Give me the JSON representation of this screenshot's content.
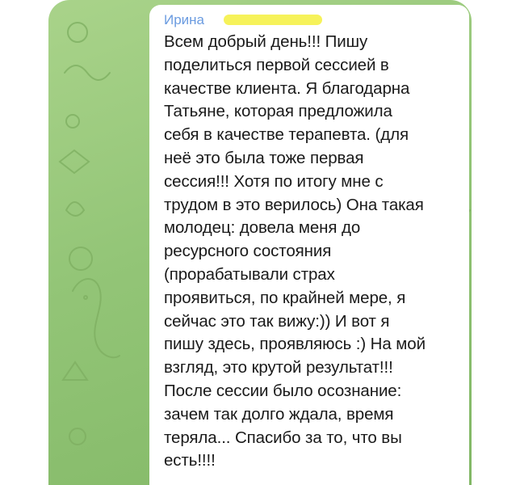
{
  "message": {
    "sender_name": "Ирина",
    "lines": [
      "Всем добрый день!!! Пишу",
      "поделиться первой сессией в",
      "качестве клиента. Я благодарна",
      "Татьяне, которая предложила",
      "себя в качестве терапевта. (для",
      "неё это была тоже первая",
      "сессия!!! Хотя по итогу мне с",
      "трудом в это верилось) Она такая",
      "молодец: довела меня до",
      "ресурсного состояния",
      "(прорабатывали страх",
      "проявиться, по крайней мере, я",
      "сейчас это так вижу:)) И вот я",
      "пишу здесь, проявляюсь :) На мой",
      "взгляд, это крутой результат!!!",
      "После сессии было осознание:",
      "зачем так долго ждала, время",
      "теряла... Спасибо за то, что вы",
      "есть!!!!"
    ]
  },
  "colors": {
    "chat_background": "#93c577",
    "bubble": "#ffffff",
    "sender_name": "#6a9be0",
    "redaction_marker": "#f6f25a",
    "text": "#1a1a1a"
  }
}
